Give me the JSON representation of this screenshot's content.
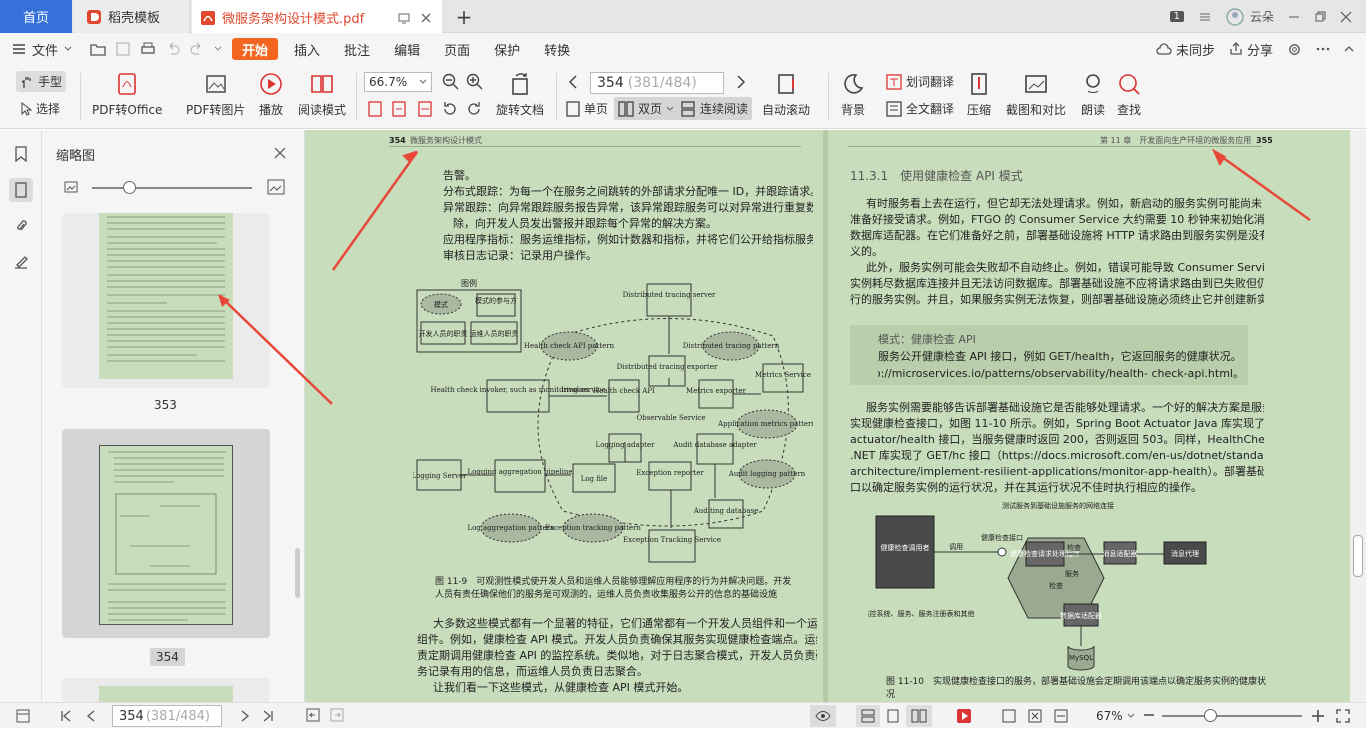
{
  "tabs": {
    "home": "首页",
    "template": "稻壳模板",
    "pdf": "微服务架构设计模式.pdf",
    "count": "1",
    "user": "云朵"
  },
  "menu": {
    "file": "文件",
    "items": [
      "开始",
      "插入",
      "批注",
      "编辑",
      "页面",
      "保护",
      "转换"
    ],
    "sync": "未同步",
    "share": "分享"
  },
  "toolbar": {
    "hand": "手型",
    "select": "选择",
    "pdf_office": "PDF转Office",
    "pdf_image": "PDF转图片",
    "play": "播放",
    "read_mode": "阅读模式",
    "zoom": "66.7%",
    "rotate": "旋转文档",
    "page_input": "354",
    "page_total": "(381/484)",
    "single": "单页",
    "double": "双页",
    "continuous": "连续阅读",
    "auto_scroll": "自动滚动",
    "background": "背景",
    "word_translate": "划词翻译",
    "full_translate": "全文翻译",
    "compress": "压缩",
    "screenshot": "截图和对比",
    "read_aloud": "朗读",
    "find": "查找"
  },
  "sidebar": {
    "title": "缩略图",
    "thumbs": [
      {
        "label": "353"
      },
      {
        "label": "354"
      }
    ]
  },
  "doc": {
    "left_header_num": "354",
    "left_header_title": "微服务架构设计模式",
    "right_header_title": "第 11 章　开发面向生产环境的微服务应用",
    "right_header_num": "355",
    "left_lines": [
      "告警。",
      "分布式跟踪：为每一个在服务之间跳转的外部请求分配唯一 ID，并跟踪请求。",
      "异常跟踪：向异常跟踪服务报告异常，该异常跟踪服务可以对异常进行重复数据删",
      "除，向开发人员发出警报并跟踪每个异常的解决方案。",
      "应用程序指标：服务运维指标，例如计数器和指标，并将它们公开给指标服务器。",
      "审核日志记录：记录用户操作。"
    ],
    "figure_caption": "图 11-9　可观测性模式使开发人员和运维人员能够理解应用程序的行为并解决问题。开发人员有责任确保他们的服务是可观测的，运维人员负责收集服务公开的信息的基础设施",
    "left_bottom": [
      "大多数这些模式都有一个显著的特征，它们通常都有一个开发人员组件和一个运维人员",
      "组件。例如，健康检查 API 模式。开发人员负责确保其服务实现健康检查端点。运维人员负",
      "责定期调用健康检查 API 的监控系统。类似地，对于日志聚合模式，开发人员负责确保其服",
      "务记录有用的信息，而运维人员负责日志聚合。",
      "让我们看一下这些模式，从健康检查 API 模式开始。"
    ],
    "section_title": "11.3.1　使用健康检查 API 模式",
    "right_lines": [
      "有时服务看上去在运行，但它却无法处理请求。例如，新启动的服务实例可能尚未",
      "准备好接受请求。例如，FTGO 的 Consumer Service 大约需要 10 秒钟来初始化消息和",
      "数据库适配器。在它们准备好之前，部署基础设施将 HTTP 请求路由到服务实例是没有意",
      "义的。",
      "此外，服务实例可能会失败却不自动终止。例如，错误可能导致 Consumer Service 的",
      "实例耗尽数据库连接并且无法访问数据库。部署基础设施不应将请求路由到已失败但仍在运",
      "行的服务实例。并且，如果服务实例无法恢复，则部署基础设施必须终止它并创建新实例。"
    ],
    "pattern_box": [
      "模式：健康检查 API",
      "服务公开健康检查 API 接口，例如 GET/health，它返回服务的健康状况。请参阅：",
      "http://microservices.io/patterns/observability/health- check-api.html。"
    ],
    "right_lines2": [
      "服务实例需要能够告诉部署基础设施它是否能够处理请求。一个好的解决方案是服务",
      "实现健康检查接口，如图 11-10 所示。例如，Spring Boot Actuator Java 库实现了一个 GET/",
      "actuator/health 接口，当服务健康时返回 200，否则返回 503。同样，HealthChecks",
      ".NET 库实现了 GET/hc 接口（https://docs.microsoft.com/en-us/dotnet/standard/microservices-",
      "architecture/implement-resilient-applications/monitor-app-health）。部署基础设施定期调用此接",
      "口以确定服务实例的运行状况，并在其运行状况不佳时执行相应的操作。"
    ],
    "fig10_caption": "图 11-10　实现健康检查接口的服务，部署基础设施会定期调用该端点以确定服务实例的健康状况",
    "fig10": {
      "top": "测试服务到基础设施服务的网络连接",
      "monitor": "健康检查调用者",
      "invoke": "调用",
      "endpoint": "健康检查接口",
      "handler": "健康检查请求处理程序",
      "check": "检查",
      "service": "服务",
      "msg": "消息适配器",
      "broker": "消息代理",
      "check2": "检查",
      "db": "数据库适配器",
      "mysql": "MySQL",
      "example": "例如：监控系统、服务、服务注册表和其他"
    },
    "fig9": {
      "legend": "图例",
      "pattern": "模式",
      "role": "模式的参与方",
      "dev": "开发人员的职责",
      "ops": "运维人员的职责",
      "dts": "Distributed tracing server",
      "dtp": "Distributed tracing pattern",
      "hcp": "Health check API pattern",
      "dte": "Distributed tracing exporter",
      "ms": "Metrics Service",
      "hci": "Health check invoker, such as monitoring service",
      "invokes": "Invokes",
      "hca": "Health check API",
      "me": "Metrics exporter",
      "amp": "Application metrics pattern",
      "os": "Observable Service",
      "la": "Logging adapter",
      "ada": "Audit database adapter",
      "alp": "Audit logging pattern",
      "ls": "Logging Server",
      "lap": "Logging aggregation pipeline",
      "lf": "Log file",
      "er": "Exception reporter",
      "ad": "Auditing database",
      "lagp": "Log aggregation pattern",
      "etp": "Exception tracking pattern",
      "ets": "Exception Tracking Service"
    }
  },
  "status": {
    "page_input": "354",
    "page_total": "(381/484)",
    "zoom": "67%"
  },
  "colors": {
    "accent": "#f26622",
    "home_tab": "#3571d8",
    "doc_bg": "#c8ddbb",
    "arrow": "#e8483a"
  }
}
